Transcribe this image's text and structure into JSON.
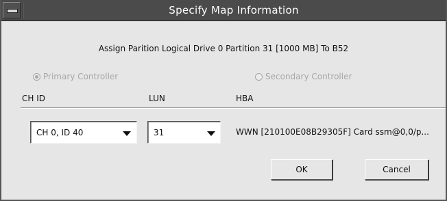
{
  "window": {
    "title": "Specify Map Information"
  },
  "assign_text": "Assign Parition Logical Drive 0 Partition 31 [1000 MB]  To B52",
  "controllers": {
    "primary": {
      "label": "Primary Controller",
      "selected": true,
      "enabled": false
    },
    "secondary": {
      "label": "Secondary Controller",
      "selected": false,
      "enabled": false
    }
  },
  "columns": {
    "chid": "CH ID",
    "lun": "LUN",
    "hba": "HBA"
  },
  "fields": {
    "chid_value": "CH 0, ID 40",
    "lun_value": "31",
    "hba_value": "WWN [210100E08B29305F] Card ssm@0,0/p..."
  },
  "buttons": {
    "ok": "OK",
    "cancel": "Cancel"
  },
  "icons": {
    "window_menu": "window-menu-icon",
    "dropdown": "chevron-down-icon",
    "radio": "radio-icon"
  }
}
